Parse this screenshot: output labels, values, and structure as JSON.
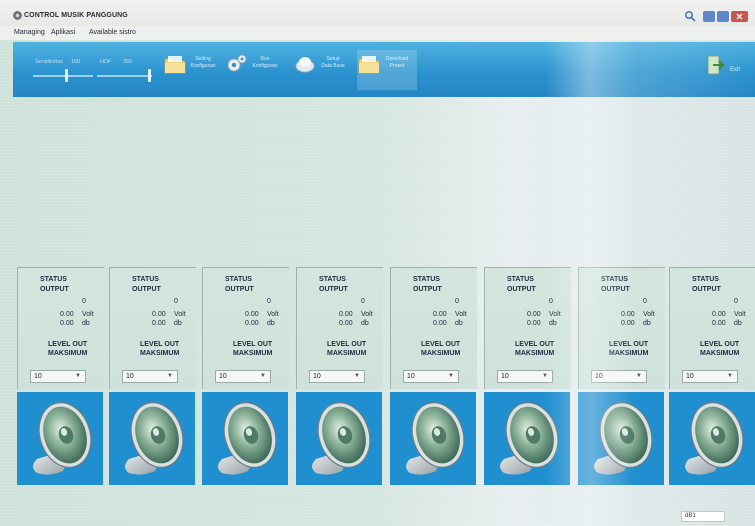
{
  "window": {
    "title": "CONTROL MUSIK PANGGUNG",
    "icons": {
      "app": "app-logo-icon",
      "search": "search-icon"
    }
  },
  "menu": {
    "items": [
      {
        "label": "Managing"
      },
      {
        "label": "Aplikasi"
      },
      {
        "label": "Available sistro"
      }
    ]
  },
  "toolbar": {
    "sliders": [
      {
        "label": "Sensitivitas",
        "value_label": "100",
        "level": 0.55
      },
      {
        "label": "HDF",
        "value_label": "350",
        "level": 0.95
      }
    ],
    "buttons": [
      {
        "label_1": "Setting",
        "label_2": "Konfigurasi",
        "icon": "folder-icon"
      },
      {
        "label_1": "Run",
        "label_2": "Konfigurasi",
        "icon": "gears-icon"
      },
      {
        "label_1": "Setup",
        "label_2": "Data Base",
        "icon": "globe-icon"
      },
      {
        "label_1": "Download",
        "label_2": "Preset",
        "icon": "folder-icon"
      }
    ],
    "exit": {
      "label": "Exit",
      "icon": "exit-icon"
    }
  },
  "channels": [
    {
      "status": "STATUS",
      "output": "OUTPUT",
      "value": "0",
      "volt": "0.00",
      "volt_unit": "Volt",
      "db": "0.00",
      "db_unit": "db",
      "level_label": "LEVEL OUT",
      "max_label": "MAKSIMUM",
      "level": "10"
    },
    {
      "status": "STATUS",
      "output": "OUTPUT",
      "value": "0",
      "volt": "0.00",
      "volt_unit": "Volt",
      "db": "0.00",
      "db_unit": "db",
      "level_label": "LEVEL OUT",
      "max_label": "MAKSIMUM",
      "level": "10"
    },
    {
      "status": "STATUS",
      "output": "OUTPUT",
      "value": "0",
      "volt": "0.00",
      "volt_unit": "Volt",
      "db": "0.00",
      "db_unit": "db",
      "level_label": "LEVEL OUT",
      "max_label": "MAKSIMUM",
      "level": "10"
    },
    {
      "status": "STATUS",
      "output": "OUTPUT",
      "value": "0",
      "volt": "0.00",
      "volt_unit": "Volt",
      "db": "0.00",
      "db_unit": "db",
      "level_label": "LEVEL OUT",
      "max_label": "MAKSIMUM",
      "level": "10"
    },
    {
      "status": "STATUS",
      "output": "OUTPUT",
      "value": "0",
      "volt": "0.00",
      "volt_unit": "Volt",
      "db": "0.00",
      "db_unit": "db",
      "level_label": "LEVEL OUT",
      "max_label": "MAKSIMUM",
      "level": "10"
    },
    {
      "status": "STATUS",
      "output": "OUTPUT",
      "value": "0",
      "volt": "0.00",
      "volt_unit": "Volt",
      "db": "0.00",
      "db_unit": "db",
      "level_label": "LEVEL OUT",
      "max_label": "MAKSIMUM",
      "level": "10"
    },
    {
      "status": "STATUS",
      "output": "OUTPUT",
      "value": "0",
      "volt": "0.00",
      "volt_unit": "Volt",
      "db": "0.00",
      "db_unit": "db",
      "level_label": "LEVEL OUT",
      "max_label": "MAKSIMUM",
      "level": "10"
    },
    {
      "status": "STATUS",
      "output": "OUTPUT",
      "value": "0",
      "volt": "0.00",
      "volt_unit": "Volt",
      "db": "0.00",
      "db_unit": "db",
      "level_label": "LEVEL OUT",
      "max_label": "MAKSIMUM",
      "level": "10"
    }
  ],
  "speaker_icon": "speaker-icon",
  "status_bar": {
    "field_value": "dB1"
  },
  "colors": {
    "toolbar": "#2b93cf",
    "speaker_tile": "#1f8fcf",
    "background": "#d4e4de",
    "close": "#c9544f",
    "window_button": "#5d87c9"
  }
}
